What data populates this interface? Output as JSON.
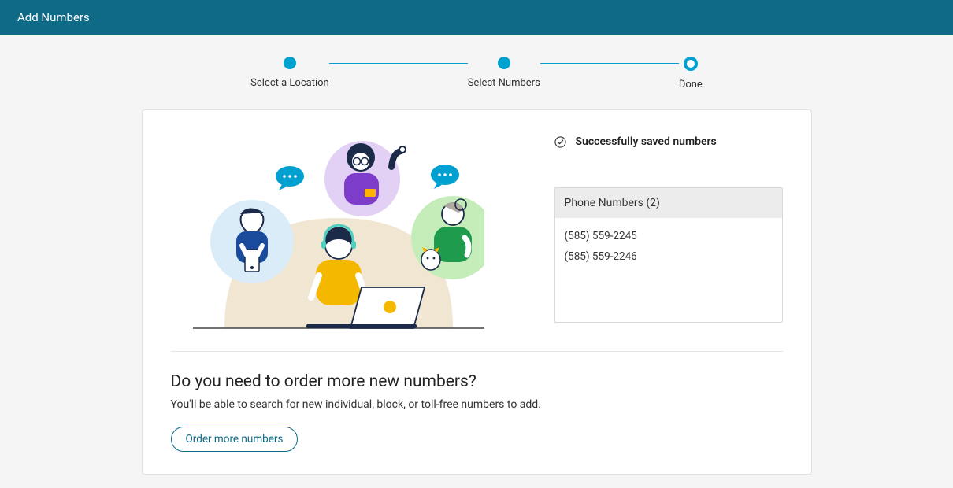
{
  "header": {
    "title": "Add Numbers"
  },
  "stepper": {
    "steps": [
      {
        "label": "Select a Location"
      },
      {
        "label": "Select Numbers"
      },
      {
        "label": "Done"
      }
    ]
  },
  "success": {
    "message": "Successfully saved numbers"
  },
  "numbersPanel": {
    "header": "Phone Numbers (2)",
    "items": [
      "(585) 559-2245",
      "(585) 559-2246"
    ]
  },
  "prompt": {
    "title": "Do you need to order more new numbers?",
    "desc": "You'll be able to search for new individual, block, or toll-free numbers to add.",
    "button": "Order more numbers"
  },
  "colors": {
    "accent": "#00a0d1",
    "headerBg": "#0f6a87"
  }
}
